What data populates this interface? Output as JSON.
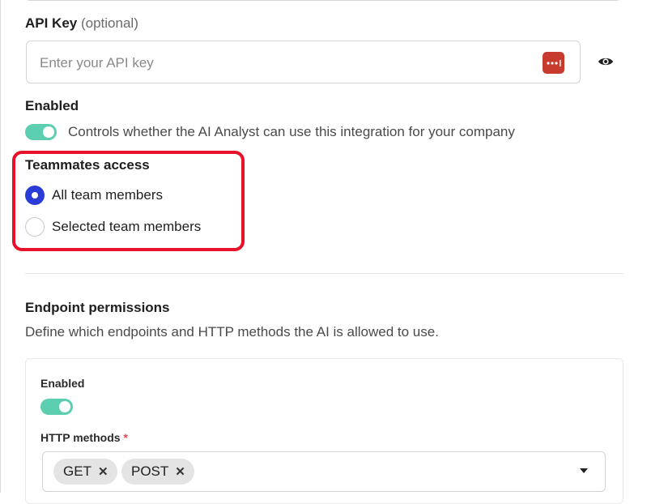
{
  "api_key": {
    "label": "API Key",
    "optional_suffix": "(optional)",
    "placeholder": "Enter your API key",
    "value": ""
  },
  "enabled": {
    "label": "Enabled",
    "description": "Controls whether the AI Analyst can use this integration for your company",
    "on": true
  },
  "teammates_access": {
    "label": "Teammates access",
    "options": [
      {
        "label": "All team members",
        "selected": true
      },
      {
        "label": "Selected team members",
        "selected": false
      }
    ]
  },
  "endpoint_permissions": {
    "title": "Endpoint permissions",
    "description": "Define which endpoints and HTTP methods the AI is allowed to use.",
    "enabled_label": "Enabled",
    "enabled_on": true,
    "http_methods_label": "HTTP methods",
    "required_marker": "*",
    "http_methods": [
      {
        "label": "GET",
        "remove_glyph": "✕"
      },
      {
        "label": "POST",
        "remove_glyph": "✕"
      }
    ]
  },
  "colors": {
    "accent_radio": "#2a3bd6",
    "toggle_on": "#5ccfb0",
    "highlight_border": "#e8102a",
    "password_manager_icon": "#c73a2e",
    "required": "#e5484d"
  },
  "icons": {
    "password_manager": "password-manager-icon",
    "visibility": "eye-icon",
    "remove": "close-icon",
    "dropdown": "chevron-down-icon"
  }
}
